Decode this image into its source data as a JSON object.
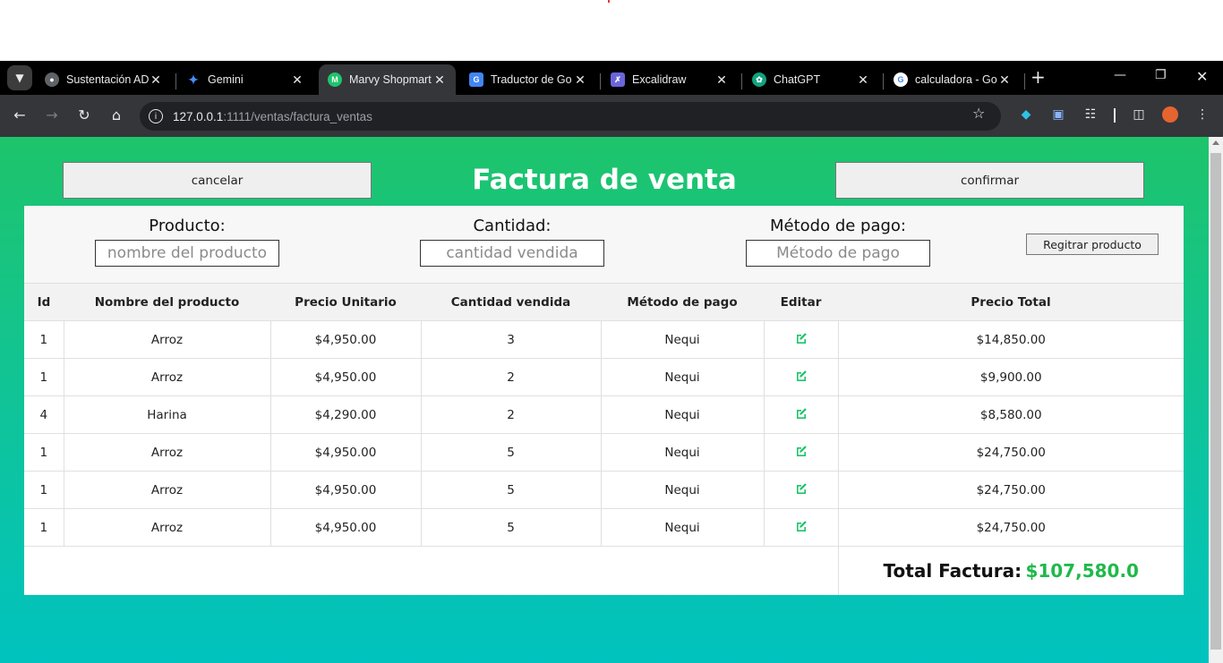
{
  "browser": {
    "tabs": [
      {
        "title": "Sustentación AD",
        "icon": "globe-icon"
      },
      {
        "title": "Gemini",
        "icon": "gemini-icon"
      },
      {
        "title": "Marvy Shopmart",
        "icon": "marvy-icon",
        "active": true
      },
      {
        "title": "Traductor de Go",
        "icon": "translate-icon"
      },
      {
        "title": "Excalidraw",
        "icon": "excalidraw-icon"
      },
      {
        "title": "ChatGPT",
        "icon": "chatgpt-icon"
      },
      {
        "title": "calculadora - Go",
        "icon": "google-icon"
      }
    ],
    "url_host": "127.0.0.1",
    "url_path": ":1111/ventas/factura_ventas"
  },
  "page": {
    "title": "Factura de venta",
    "cancel_label": "cancelar",
    "confirm_label": "confirmar"
  },
  "form": {
    "product_label": "Producto:",
    "product_placeholder": "nombre del producto",
    "quantity_label": "Cantidad:",
    "quantity_placeholder": "cantidad vendida",
    "payment_label": "Método de pago:",
    "payment_placeholder": "Método de pago",
    "register_label": "Regitrar producto"
  },
  "table": {
    "headers": [
      "Id",
      "Nombre del producto",
      "Precio Unitario",
      "Cantidad vendida",
      "Método de pago",
      "Editar",
      "Precio Total"
    ],
    "rows": [
      {
        "id": "1",
        "name": "Arroz",
        "unit": "$4,950.00",
        "qty": "3",
        "method": "Nequi",
        "total": "$14,850.00"
      },
      {
        "id": "1",
        "name": "Arroz",
        "unit": "$4,950.00",
        "qty": "2",
        "method": "Nequi",
        "total": "$9,900.00"
      },
      {
        "id": "4",
        "name": "Harina",
        "unit": "$4,290.00",
        "qty": "2",
        "method": "Nequi",
        "total": "$8,580.00"
      },
      {
        "id": "1",
        "name": "Arroz",
        "unit": "$4,950.00",
        "qty": "5",
        "method": "Nequi",
        "total": "$24,750.00"
      },
      {
        "id": "1",
        "name": "Arroz",
        "unit": "$4,950.00",
        "qty": "5",
        "method": "Nequi",
        "total": "$24,750.00"
      },
      {
        "id": "1",
        "name": "Arroz",
        "unit": "$4,950.00",
        "qty": "5",
        "method": "Nequi",
        "total": "$24,750.00"
      }
    ],
    "total_label": "Total Factura:",
    "total_value": "$107,580.0"
  },
  "colors": {
    "accent_green": "#1fb94a",
    "edit_icon": "#1ec46b",
    "gradient_top": "#1ec46b",
    "gradient_bottom": "#00c3bf"
  }
}
